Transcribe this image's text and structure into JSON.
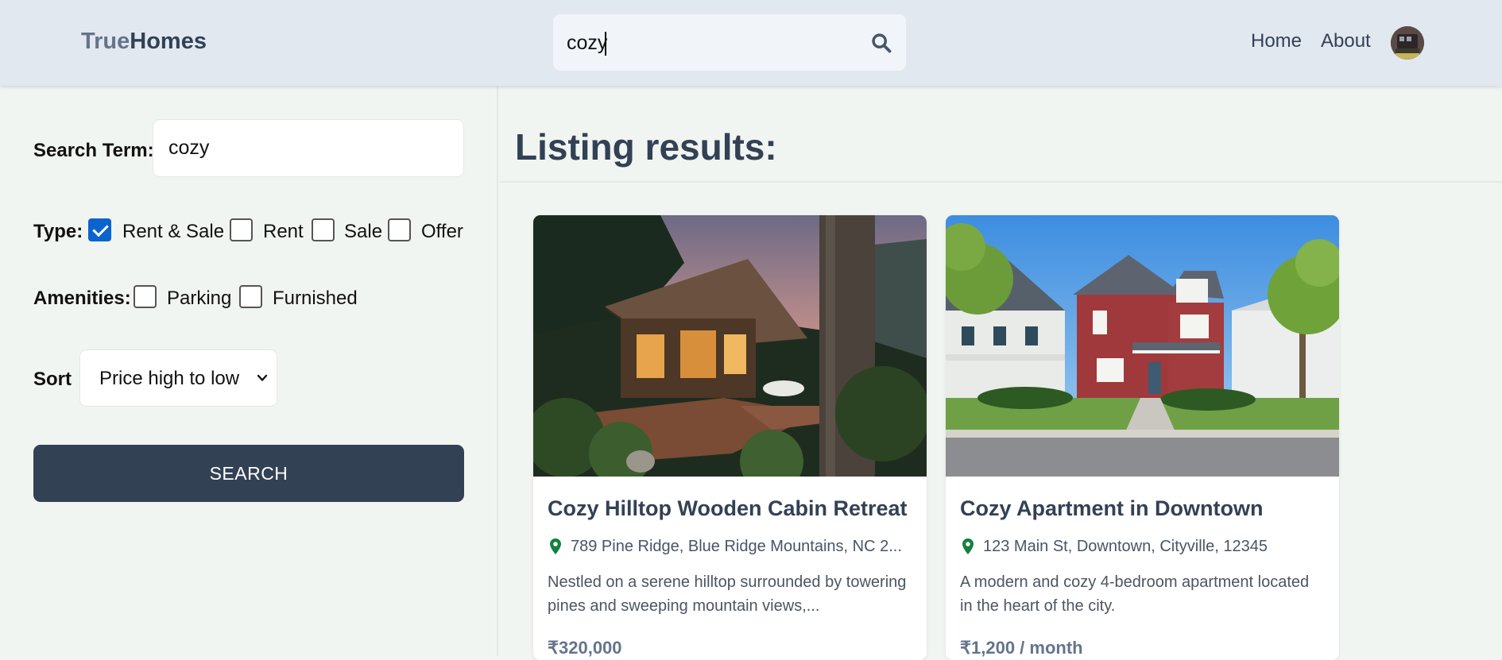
{
  "header": {
    "logo_part1": "True",
    "logo_part2": "Homes",
    "search_value": "cozy",
    "nav": {
      "home": "Home",
      "about": "About"
    }
  },
  "sidebar": {
    "search_term_label": "Search Term:",
    "search_term_value": "cozy",
    "type_label": "Type:",
    "type_options": [
      {
        "label": "Rent & Sale",
        "checked": true
      },
      {
        "label": "Rent",
        "checked": false
      },
      {
        "label": "Sale",
        "checked": false
      },
      {
        "label": "Offer",
        "checked": false
      }
    ],
    "amenities_label": "Amenities:",
    "amenities_options": [
      {
        "label": "Parking",
        "checked": false
      },
      {
        "label": "Furnished",
        "checked": false
      }
    ],
    "sort_label": "Sort",
    "sort_value": "Price high to low",
    "search_button": "SEARCH"
  },
  "main": {
    "title": "Listing results:",
    "listings": [
      {
        "title": "Cozy Hilltop Wooden Cabin Retreat",
        "address": "789 Pine Ridge, Blue Ridge Mountains, NC 2...",
        "description": "Nestled on a serene hilltop surrounded by towering pines and sweeping mountain views,...",
        "price": "₹320,000"
      },
      {
        "title": "Cozy Apartment in Downtown",
        "address": "123 Main St, Downtown, Cityville, 12345",
        "description": "A modern and cozy 4-bedroom apartment located in the heart of the city.",
        "price": "₹1,200 / month"
      }
    ]
  },
  "colors": {
    "header_bg": "#e2e8f0",
    "page_bg": "#f1f5f1",
    "button_bg": "#334155",
    "checkbox_accent": "#0b63ce",
    "pin_color": "#15803d"
  },
  "icons": [
    "search-icon",
    "map-pin-icon",
    "chevron-down-icon",
    "checkmark-icon"
  ]
}
